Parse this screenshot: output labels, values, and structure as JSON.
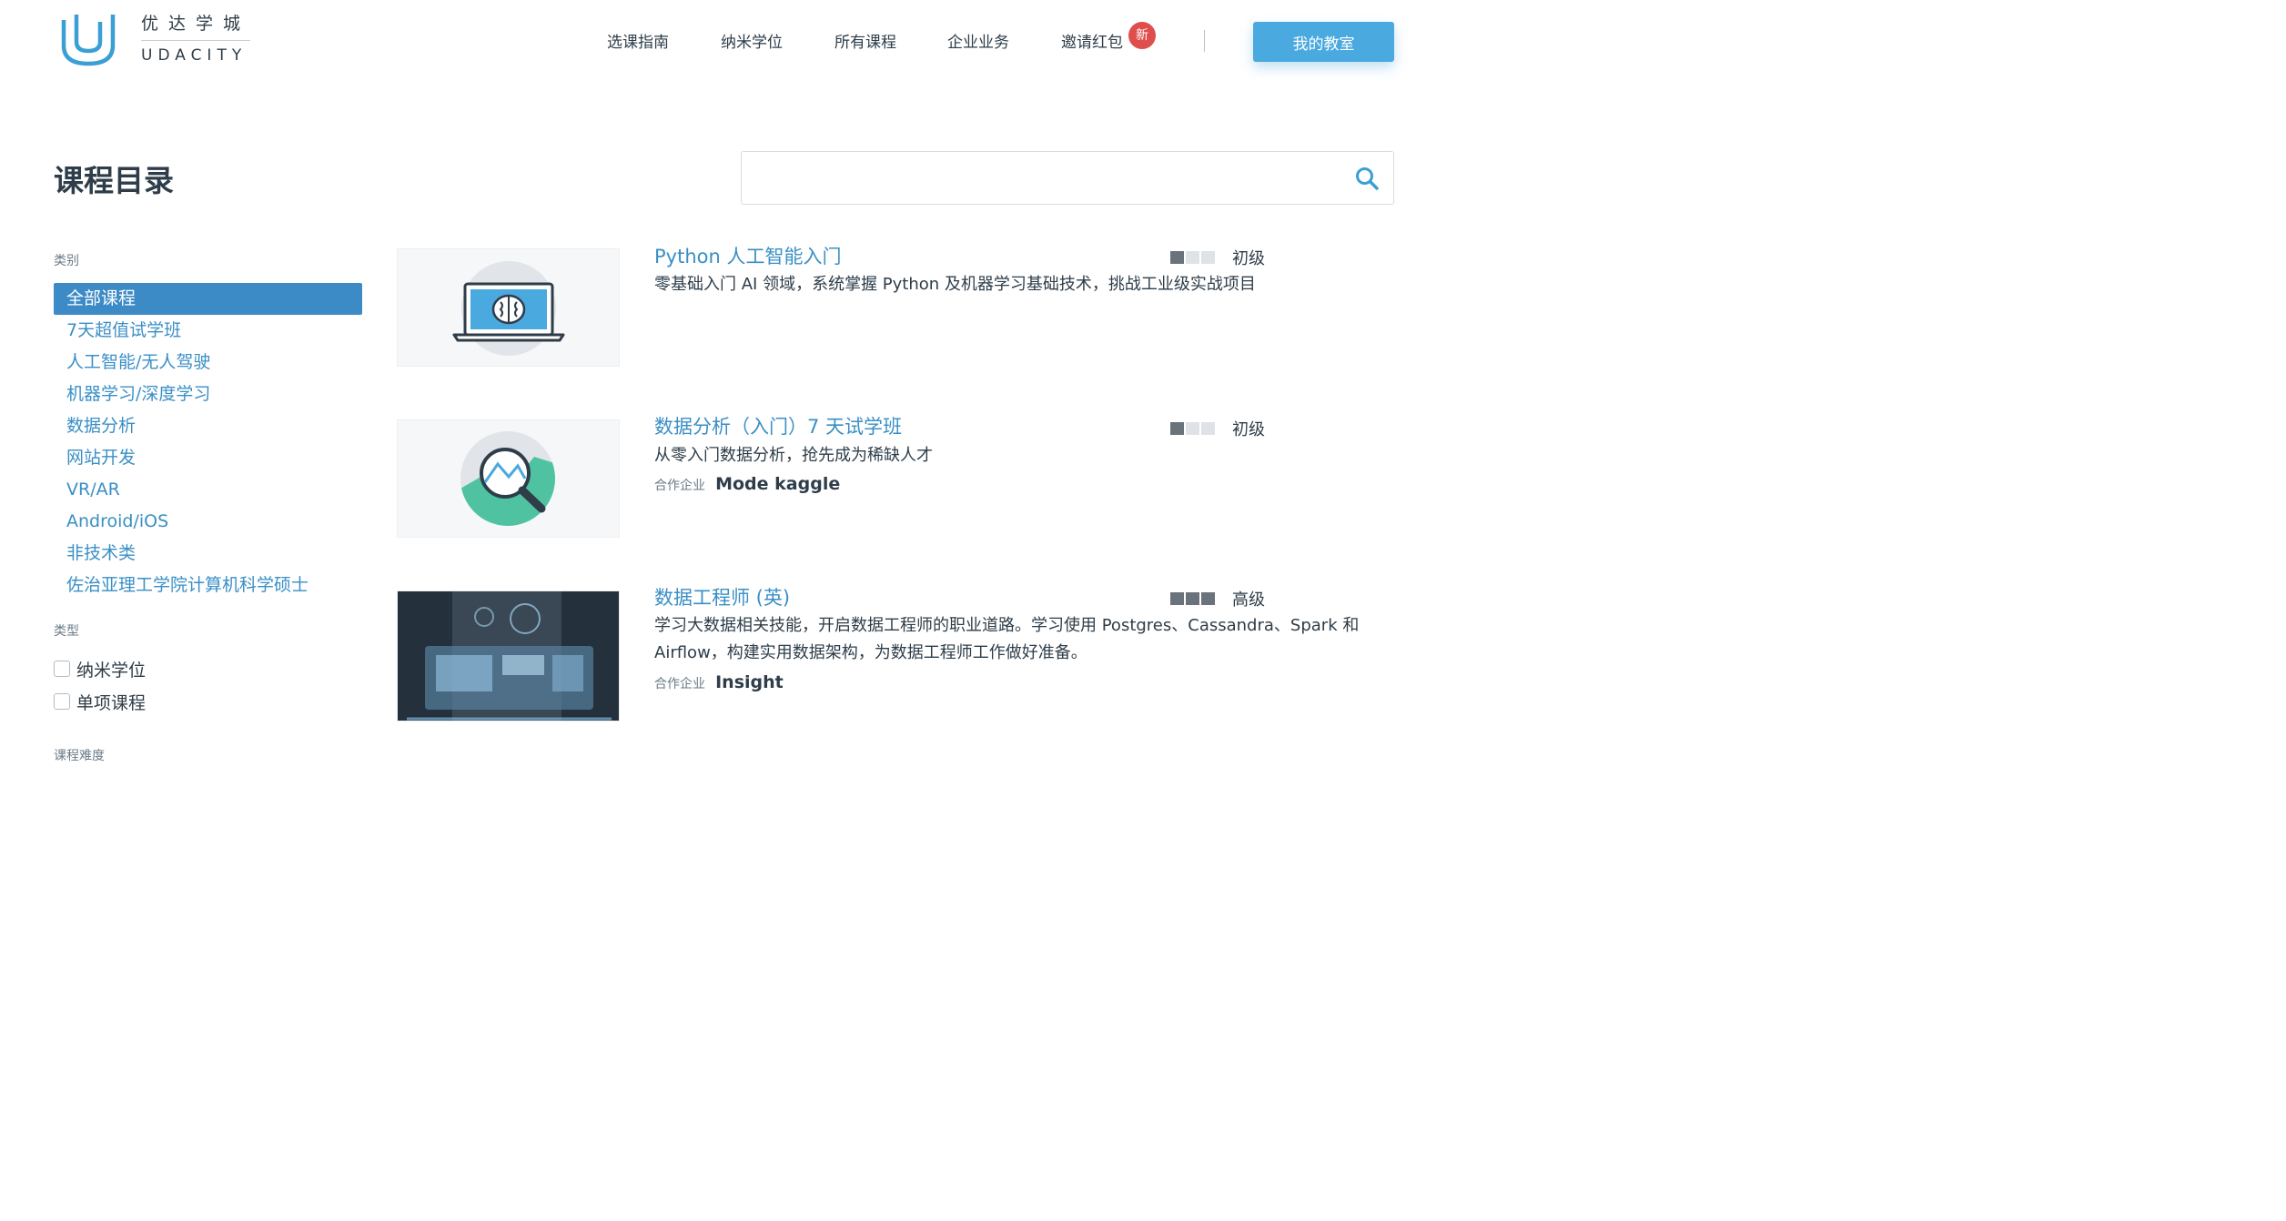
{
  "brand": {
    "name_cn": "优达学城",
    "name_en": "UDACITY"
  },
  "nav": {
    "items": [
      "选课指南",
      "纳米学位",
      "所有课程",
      "企业业务",
      "邀请红包"
    ],
    "badge": "新",
    "classroom_button": "我的教室"
  },
  "page": {
    "title": "课程目录"
  },
  "search": {
    "placeholder": "",
    "value": ""
  },
  "sidebar": {
    "category_label": "类别",
    "categories": [
      "全部课程",
      "7天超值试学班",
      "人工智能/无人驾驶",
      "机器学习/深度学习",
      "数据分析",
      "网站开发",
      "VR/AR",
      "Android/iOS",
      "非技术类",
      "佐治亚理工学院计算机科学硕士"
    ],
    "active_category": "全部课程",
    "type_label": "类型",
    "types": [
      "纳米学位",
      "单项课程"
    ],
    "difficulty_label": "课程难度"
  },
  "courses": [
    {
      "title": "Python 人工智能入门",
      "description": "零基础入门 AI 领域，系统掌握 Python 及机器学习基础技术，挑战工业级实战项目",
      "level": "初级",
      "level_value": 1,
      "level_max": 3,
      "partner_label": "",
      "partner": "",
      "thumbnail_icon": "laptop-brain-icon"
    },
    {
      "title": "数据分析（入门）7 天试学班",
      "description": "从零入门数据分析，抢先成为稀缺人才",
      "level": "初级",
      "level_value": 1,
      "level_max": 3,
      "partner_label": "合作企业",
      "partner": "Mode kaggle",
      "thumbnail_icon": "magnifier-chart-icon"
    },
    {
      "title": "数据工程师 (英)",
      "description": "学习大数据相关技能，开启数据工程师的职业道路。学习使用 Postgres、Cassandra、Spark 和 Airflow，构建实用数据架构，为数据工程师工作做好准备。",
      "level": "高级",
      "level_value": 3,
      "level_max": 3,
      "partner_label": "合作企业",
      "partner": "Insight",
      "thumbnail_icon": "data-tablet-photo"
    }
  ],
  "colors": {
    "accent": "#3a8fc6",
    "button": "#4aa9de",
    "badge": "#e04d4d",
    "text": "#2e3d49"
  }
}
